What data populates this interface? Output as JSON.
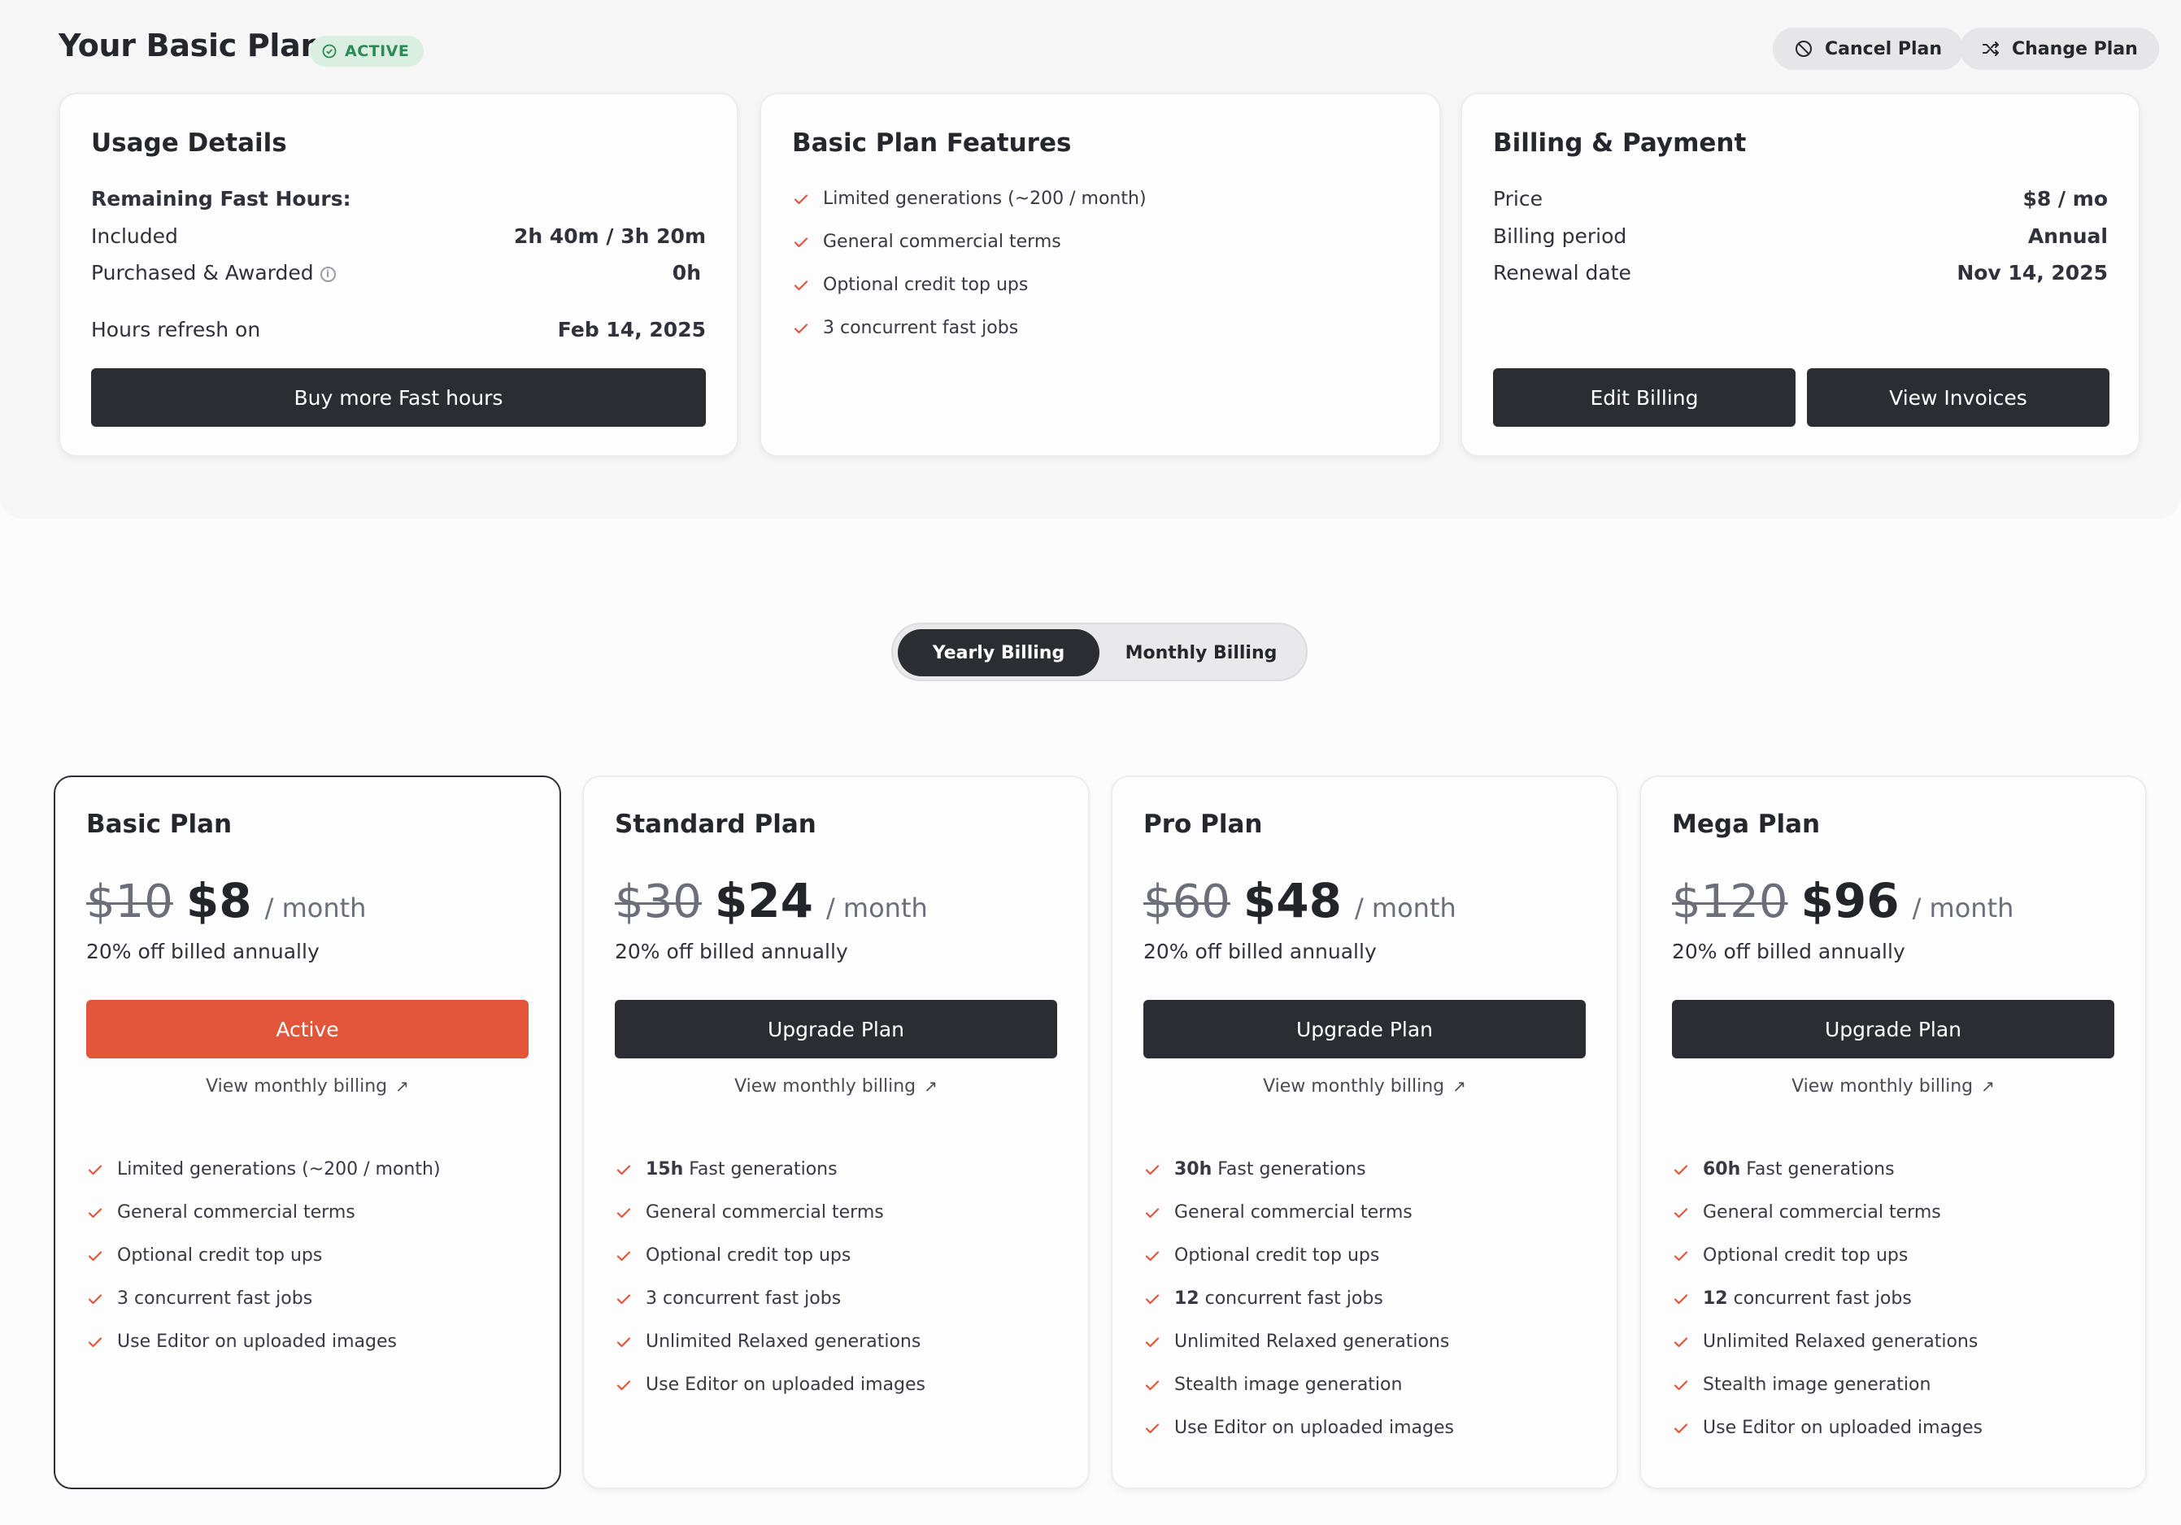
{
  "header": {
    "title": "Your Basic Plan",
    "badge": "ACTIVE",
    "cancel_label": "Cancel Plan",
    "change_label": "Change Plan"
  },
  "usage": {
    "title": "Usage Details",
    "remaining_label": "Remaining Fast Hours:",
    "included_label": "Included",
    "included_value": "2h 40m / 3h 20m",
    "purchased_label": "Purchased & Awarded",
    "purchased_value": "0h",
    "refresh_label": "Hours refresh on",
    "refresh_value": "Feb 14, 2025",
    "button": "Buy more Fast hours"
  },
  "features": {
    "title": "Basic Plan Features",
    "items": [
      "Limited generations (~200 / month)",
      "General commercial terms",
      "Optional credit top ups",
      "3 concurrent fast jobs"
    ]
  },
  "billing": {
    "title": "Billing & Payment",
    "price_label": "Price",
    "price_value": "$8 / mo",
    "period_label": "Billing period",
    "period_value": "Annual",
    "renewal_label": "Renewal date",
    "renewal_value": "Nov 14, 2025",
    "edit_button": "Edit Billing",
    "invoices_button": "View Invoices"
  },
  "toggle": {
    "yearly": "Yearly Billing",
    "monthly": "Monthly Billing",
    "selected": "yearly"
  },
  "plans": [
    {
      "name": "Basic Plan",
      "old_price": "$10",
      "price": "$8",
      "per": "/ month",
      "discount": "20% off billed annually",
      "button": "Active",
      "link": "View monthly billing",
      "features": [
        {
          "b": "",
          "t": "Limited generations (~200 / month)"
        },
        {
          "b": "",
          "t": "General commercial terms"
        },
        {
          "b": "",
          "t": "Optional credit top ups"
        },
        {
          "b": "",
          "t": "3 concurrent fast jobs"
        },
        {
          "b": "",
          "t": "Use Editor on uploaded images"
        }
      ]
    },
    {
      "name": "Standard Plan",
      "old_price": "$30",
      "price": "$24",
      "per": "/ month",
      "discount": "20% off billed annually",
      "button": "Upgrade Plan",
      "link": "View monthly billing",
      "features": [
        {
          "b": "15h",
          "t": "Fast generations"
        },
        {
          "b": "",
          "t": "General commercial terms"
        },
        {
          "b": "",
          "t": "Optional credit top ups"
        },
        {
          "b": "",
          "t": "3 concurrent fast jobs"
        },
        {
          "b": "",
          "t": "Unlimited Relaxed generations"
        },
        {
          "b": "",
          "t": "Use Editor on uploaded images"
        }
      ]
    },
    {
      "name": "Pro Plan",
      "old_price": "$60",
      "price": "$48",
      "per": "/ month",
      "discount": "20% off billed annually",
      "button": "Upgrade Plan",
      "link": "View monthly billing",
      "features": [
        {
          "b": "30h",
          "t": "Fast generations"
        },
        {
          "b": "",
          "t": "General commercial terms"
        },
        {
          "b": "",
          "t": "Optional credit top ups"
        },
        {
          "b": "12",
          "t": "concurrent fast jobs"
        },
        {
          "b": "",
          "t": "Unlimited Relaxed generations"
        },
        {
          "b": "",
          "t": "Stealth image generation"
        },
        {
          "b": "",
          "t": "Use Editor on uploaded images"
        }
      ]
    },
    {
      "name": "Mega Plan",
      "old_price": "$120",
      "price": "$96",
      "per": "/ month",
      "discount": "20% off billed annually",
      "button": "Upgrade Plan",
      "link": "View monthly billing",
      "features": [
        {
          "b": "60h",
          "t": "Fast generations"
        },
        {
          "b": "",
          "t": "General commercial terms"
        },
        {
          "b": "",
          "t": "Optional credit top ups"
        },
        {
          "b": "12",
          "t": "concurrent fast jobs"
        },
        {
          "b": "",
          "t": "Unlimited Relaxed generations"
        },
        {
          "b": "",
          "t": "Stealth image generation"
        },
        {
          "b": "",
          "t": "Use Editor on uploaded images"
        }
      ]
    }
  ],
  "colors": {
    "accent": "#e3553a",
    "dark": "#2b2d33",
    "active_green": "#2c8a54"
  }
}
